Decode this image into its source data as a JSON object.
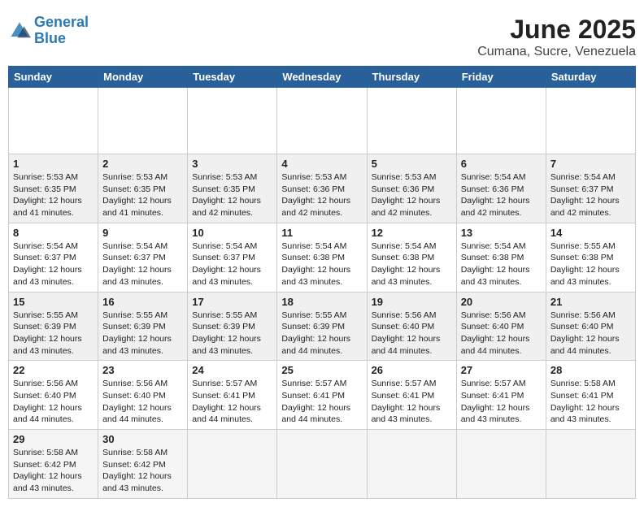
{
  "header": {
    "logo_line1": "General",
    "logo_line2": "Blue",
    "main_title": "June 2025",
    "subtitle": "Cumana, Sucre, Venezuela"
  },
  "calendar": {
    "days_of_week": [
      "Sunday",
      "Monday",
      "Tuesday",
      "Wednesday",
      "Thursday",
      "Friday",
      "Saturday"
    ],
    "weeks": [
      [
        null,
        null,
        null,
        null,
        null,
        null,
        null
      ]
    ],
    "cells": [
      [
        null,
        null,
        null,
        null,
        null,
        null,
        null
      ],
      [
        {
          "day": "1",
          "sunrise": "5:53 AM",
          "sunset": "6:35 PM",
          "daylight": "12 hours and 41 minutes."
        },
        {
          "day": "2",
          "sunrise": "5:53 AM",
          "sunset": "6:35 PM",
          "daylight": "12 hours and 41 minutes."
        },
        {
          "day": "3",
          "sunrise": "5:53 AM",
          "sunset": "6:35 PM",
          "daylight": "12 hours and 42 minutes."
        },
        {
          "day": "4",
          "sunrise": "5:53 AM",
          "sunset": "6:36 PM",
          "daylight": "12 hours and 42 minutes."
        },
        {
          "day": "5",
          "sunrise": "5:53 AM",
          "sunset": "6:36 PM",
          "daylight": "12 hours and 42 minutes."
        },
        {
          "day": "6",
          "sunrise": "5:54 AM",
          "sunset": "6:36 PM",
          "daylight": "12 hours and 42 minutes."
        },
        {
          "day": "7",
          "sunrise": "5:54 AM",
          "sunset": "6:37 PM",
          "daylight": "12 hours and 42 minutes."
        }
      ],
      [
        {
          "day": "8",
          "sunrise": "5:54 AM",
          "sunset": "6:37 PM",
          "daylight": "12 hours and 43 minutes."
        },
        {
          "day": "9",
          "sunrise": "5:54 AM",
          "sunset": "6:37 PM",
          "daylight": "12 hours and 43 minutes."
        },
        {
          "day": "10",
          "sunrise": "5:54 AM",
          "sunset": "6:37 PM",
          "daylight": "12 hours and 43 minutes."
        },
        {
          "day": "11",
          "sunrise": "5:54 AM",
          "sunset": "6:38 PM",
          "daylight": "12 hours and 43 minutes."
        },
        {
          "day": "12",
          "sunrise": "5:54 AM",
          "sunset": "6:38 PM",
          "daylight": "12 hours and 43 minutes."
        },
        {
          "day": "13",
          "sunrise": "5:54 AM",
          "sunset": "6:38 PM",
          "daylight": "12 hours and 43 minutes."
        },
        {
          "day": "14",
          "sunrise": "5:55 AM",
          "sunset": "6:38 PM",
          "daylight": "12 hours and 43 minutes."
        }
      ],
      [
        {
          "day": "15",
          "sunrise": "5:55 AM",
          "sunset": "6:39 PM",
          "daylight": "12 hours and 43 minutes."
        },
        {
          "day": "16",
          "sunrise": "5:55 AM",
          "sunset": "6:39 PM",
          "daylight": "12 hours and 43 minutes."
        },
        {
          "day": "17",
          "sunrise": "5:55 AM",
          "sunset": "6:39 PM",
          "daylight": "12 hours and 43 minutes."
        },
        {
          "day": "18",
          "sunrise": "5:55 AM",
          "sunset": "6:39 PM",
          "daylight": "12 hours and 44 minutes."
        },
        {
          "day": "19",
          "sunrise": "5:56 AM",
          "sunset": "6:40 PM",
          "daylight": "12 hours and 44 minutes."
        },
        {
          "day": "20",
          "sunrise": "5:56 AM",
          "sunset": "6:40 PM",
          "daylight": "12 hours and 44 minutes."
        },
        {
          "day": "21",
          "sunrise": "5:56 AM",
          "sunset": "6:40 PM",
          "daylight": "12 hours and 44 minutes."
        }
      ],
      [
        {
          "day": "22",
          "sunrise": "5:56 AM",
          "sunset": "6:40 PM",
          "daylight": "12 hours and 44 minutes."
        },
        {
          "day": "23",
          "sunrise": "5:56 AM",
          "sunset": "6:40 PM",
          "daylight": "12 hours and 44 minutes."
        },
        {
          "day": "24",
          "sunrise": "5:57 AM",
          "sunset": "6:41 PM",
          "daylight": "12 hours and 44 minutes."
        },
        {
          "day": "25",
          "sunrise": "5:57 AM",
          "sunset": "6:41 PM",
          "daylight": "12 hours and 44 minutes."
        },
        {
          "day": "26",
          "sunrise": "5:57 AM",
          "sunset": "6:41 PM",
          "daylight": "12 hours and 43 minutes."
        },
        {
          "day": "27",
          "sunrise": "5:57 AM",
          "sunset": "6:41 PM",
          "daylight": "12 hours and 43 minutes."
        },
        {
          "day": "28",
          "sunrise": "5:58 AM",
          "sunset": "6:41 PM",
          "daylight": "12 hours and 43 minutes."
        }
      ],
      [
        {
          "day": "29",
          "sunrise": "5:58 AM",
          "sunset": "6:42 PM",
          "daylight": "12 hours and 43 minutes."
        },
        {
          "day": "30",
          "sunrise": "5:58 AM",
          "sunset": "6:42 PM",
          "daylight": "12 hours and 43 minutes."
        },
        null,
        null,
        null,
        null,
        null
      ]
    ]
  }
}
